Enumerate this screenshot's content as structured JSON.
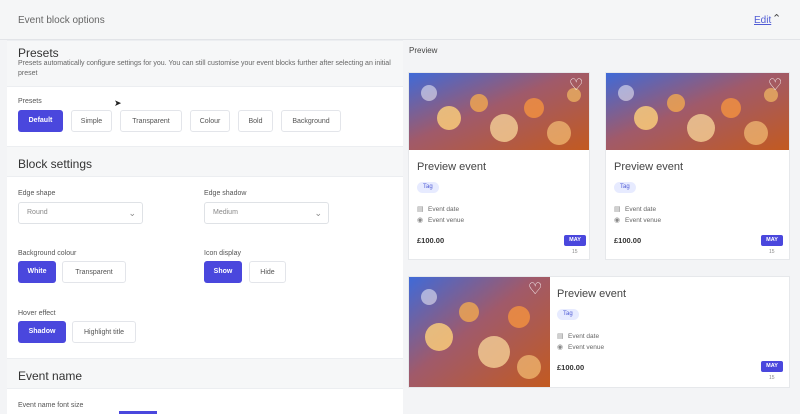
{
  "header": {
    "title": "Event block options",
    "edit_label": "Edit"
  },
  "presets": {
    "section_title": "Presets",
    "description": "Presets automatically configure settings for you. You can still customise your event blocks further after selecting an initial preset",
    "field_label": "Presets",
    "options": [
      "Default",
      "Simple",
      "Transparent",
      "Colour",
      "Bold",
      "Background"
    ],
    "selected": "Default"
  },
  "block_settings": {
    "section_title": "Block settings",
    "edge_shape": {
      "label": "Edge shape",
      "value": "Round"
    },
    "edge_shadow": {
      "label": "Edge shadow",
      "value": "Medium"
    },
    "background_colour": {
      "label": "Background colour",
      "options": [
        "White",
        "Transparent"
      ],
      "selected": "White"
    },
    "icon_display": {
      "label": "Icon display",
      "options": [
        "Show",
        "Hide"
      ],
      "selected": "Show"
    },
    "hover_effect": {
      "label": "Hover effect",
      "options": [
        "Shadow",
        "Highlight title"
      ],
      "selected": "Shadow"
    }
  },
  "event_name": {
    "section_title": "Event name",
    "font_size_label": "Event name font size"
  },
  "preview": {
    "label": "Preview",
    "cards": [
      {
        "title": "Preview event",
        "tag": "Tag",
        "date_label": "Event date",
        "venue_label": "Event venue",
        "price": "£100.00",
        "month": "MAY",
        "day": "15"
      },
      {
        "title": "Preview event",
        "tag": "Tag",
        "date_label": "Event date",
        "venue_label": "Event venue",
        "price": "£100.00",
        "month": "MAY",
        "day": "15"
      },
      {
        "title": "Preview event",
        "tag": "Tag",
        "date_label": "Event date",
        "venue_label": "Event venue",
        "price": "£100.00",
        "month": "MAY",
        "day": "15"
      }
    ]
  },
  "colors": {
    "accent": "#4a47dd",
    "tag_bg": "#e7ebff",
    "link": "#4f5bd5"
  },
  "icons": {
    "collapse": "chevron-up-icon",
    "favourite": "heart-icon",
    "date": "calendar-icon",
    "venue": "location-pin-icon",
    "dropdown": "chevron-down-icon"
  }
}
